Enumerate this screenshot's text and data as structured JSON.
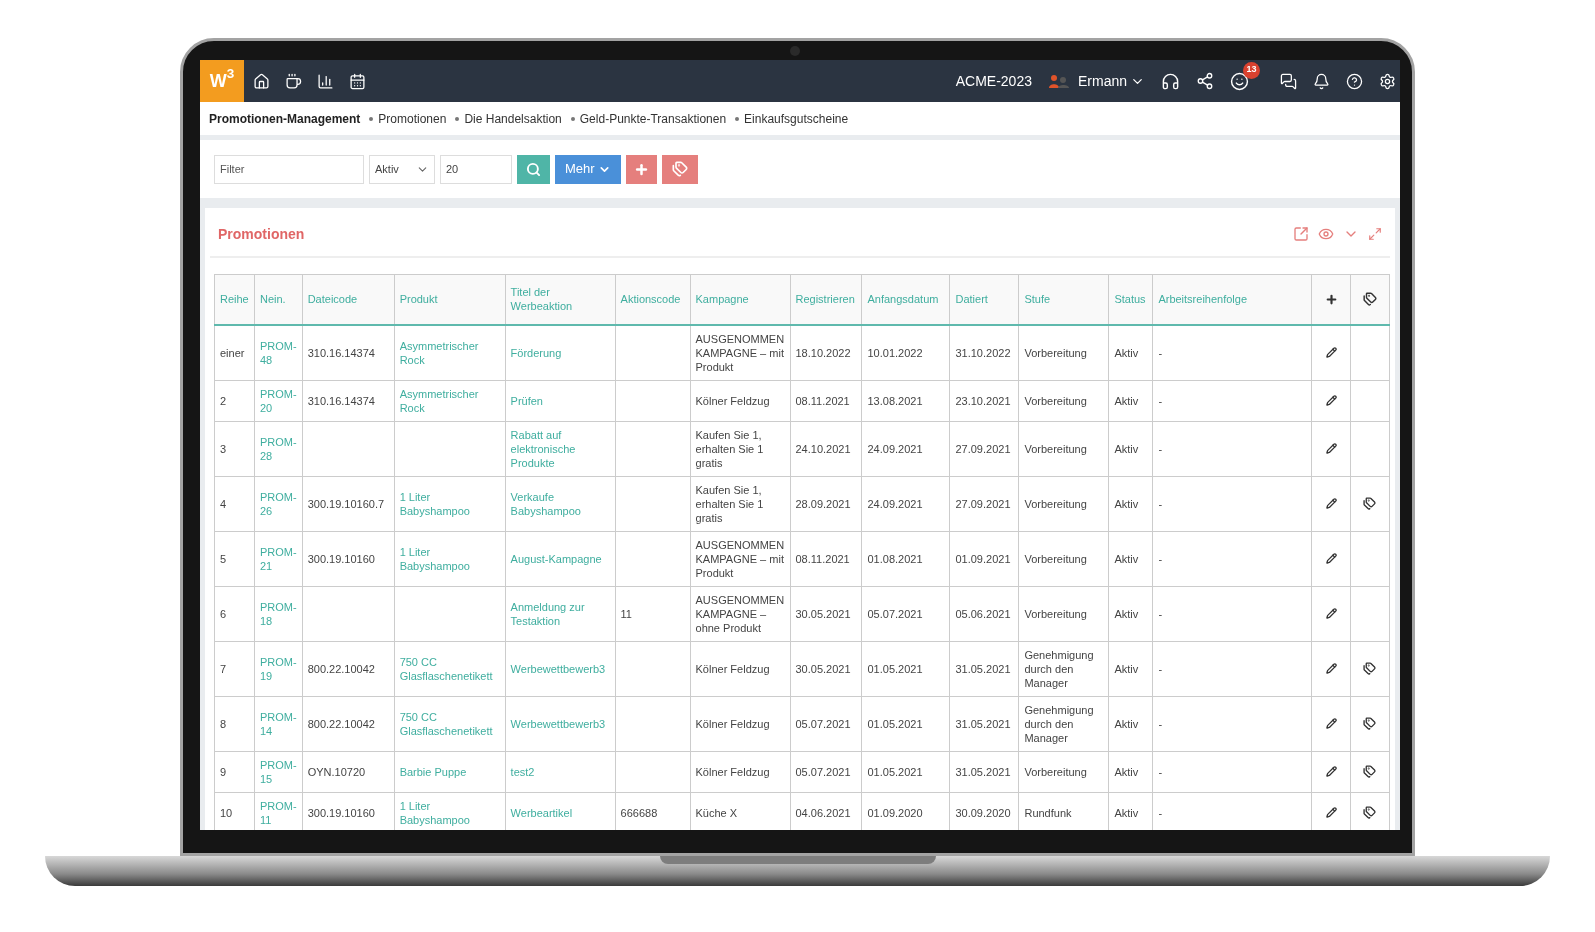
{
  "topbar": {
    "logo": "W$^{3}$",
    "company": "ACME-2023",
    "user": "Ermann",
    "notification_count": "13"
  },
  "breadcrumb": [
    {
      "label": "Promotionen-Management",
      "selected": true
    },
    {
      "label": "Promotionen",
      "selected": false
    },
    {
      "label": "Die Handelsaktion",
      "selected": false
    },
    {
      "label": "Geld-Punkte-Transaktionen",
      "selected": false
    },
    {
      "label": "Einkaufsgutscheine",
      "selected": false
    }
  ],
  "toolbar": {
    "filter": {
      "placeholder": "Filter"
    },
    "status_select": "Aktiv",
    "page_size": "20",
    "more_button": "Mehr"
  },
  "panel": {
    "title": "Promotionen"
  },
  "table": {
    "columns": [
      "Reihe",
      "Nein.",
      "Dateicode",
      "Produkt",
      "Titel der Werbeaktion",
      "Aktionscode",
      "Kampagne",
      "Registrieren",
      "Anfangsdatum",
      "Datiert",
      "Stufe",
      "Status",
      "Arbeitsreihenfolge"
    ],
    "rows": [
      {
        "row": "einer",
        "number": "PROM-48",
        "file_code": "310.16.14374",
        "product": "Asymmetrischer Rock",
        "title": "Förderung",
        "campaign": "AUSGENOMMEN KAMPAGNE – mit Produkt",
        "registered": "18.10.2022",
        "start_date": "10.01.2022",
        "dated": "31.10.2022",
        "stage": "Vorbereitung",
        "status": "Aktiv",
        "workflow": "-",
        "tagged": false
      },
      {
        "row": "2",
        "number": "PROM-20",
        "file_code": "310.16.14374",
        "product": "Asymmetrischer Rock",
        "title": "Prüfen",
        "campaign": "Kölner Feldzug",
        "registered": "08.11.2021",
        "start_date": "13.08.2021",
        "dated": "23.10.2021",
        "stage": "Vorbereitung",
        "status": "Aktiv",
        "workflow": "-",
        "tagged": false
      },
      {
        "row": "3",
        "number": "PROM-28",
        "title": "Rabatt auf elektronische Produkte",
        "campaign": "Kaufen Sie 1, erhalten Sie 1 gratis",
        "registered": "24.10.2021",
        "start_date": "24.09.2021",
        "dated": "27.09.2021",
        "stage": "Vorbereitung",
        "status": "Aktiv",
        "workflow": "-",
        "tagged": false
      },
      {
        "row": "4",
        "number": "PROM-26",
        "file_code": "300.19.10160.7",
        "product": "1 Liter Babyshampoo",
        "title": "Verkaufe Babyshampoo",
        "campaign": "Kaufen Sie 1, erhalten Sie 1 gratis",
        "registered": "28.09.2021",
        "start_date": "24.09.2021",
        "dated": "27.09.2021",
        "stage": "Vorbereitung",
        "status": "Aktiv",
        "workflow": "-",
        "tagged": true
      },
      {
        "row": "5",
        "number": "PROM-21",
        "file_code": "300.19.10160",
        "product": "1 Liter Babyshampoo",
        "title": "August-Kampagne",
        "campaign": "AUSGENOMMEN KAMPAGNE – mit Produkt",
        "registered": "08.11.2021",
        "start_date": "01.08.2021",
        "dated": "01.09.2021",
        "stage": "Vorbereitung",
        "status": "Aktiv",
        "workflow": "-",
        "tagged": false
      },
      {
        "row": "6",
        "number": "PROM-18",
        "title": "Anmeldung zur Testaktion",
        "action_code": "11",
        "campaign": "AUSGENOMMEN KAMPAGNE – ohne Produkt",
        "registered": "30.05.2021",
        "start_date": "05.07.2021",
        "dated": "05.06.2021",
        "stage": "Vorbereitung",
        "status": "Aktiv",
        "workflow": "-",
        "tagged": false
      },
      {
        "row": "7",
        "number": "PROM-19",
        "file_code": "800.22.10042",
        "product": "750 CC Glasflaschenetikett",
        "title": "Werbewettbewerb3",
        "campaign": "Kölner Feldzug",
        "registered": "30.05.2021",
        "start_date": "01.05.2021",
        "dated": "31.05.2021",
        "stage": "Genehmigung durch den Manager",
        "status": "Aktiv",
        "workflow": "-",
        "tagged": true
      },
      {
        "row": "8",
        "number": "PROM-14",
        "file_code": "800.22.10042",
        "product": "750 CC Glasflaschenetikett",
        "title": "Werbewettbewerb3",
        "campaign": "Kölner Feldzug",
        "registered": "05.07.2021",
        "start_date": "01.05.2021",
        "dated": "31.05.2021",
        "stage": "Genehmigung durch den Manager",
        "status": "Aktiv",
        "workflow": "-",
        "tagged": true
      },
      {
        "row": "9",
        "number": "PROM-15",
        "file_code": "OYN.10720",
        "product": "Barbie Puppe",
        "title": "test2",
        "campaign": "Kölner Feldzug",
        "registered": "05.07.2021",
        "start_date": "01.05.2021",
        "dated": "31.05.2021",
        "stage": "Vorbereitung",
        "status": "Aktiv",
        "workflow": "-",
        "tagged": true
      },
      {
        "row": "10",
        "number": "PROM-11",
        "file_code": "300.19.10160",
        "product": "1 Liter Babyshampoo",
        "title": "Werbeartikel",
        "action_code": "666688",
        "campaign": "Küche X",
        "registered": "04.06.2021",
        "start_date": "01.09.2020",
        "dated": "30.09.2020",
        "stage": "Rundfunk",
        "status": "Aktiv",
        "workflow": "-",
        "tagged": true
      }
    ]
  }
}
